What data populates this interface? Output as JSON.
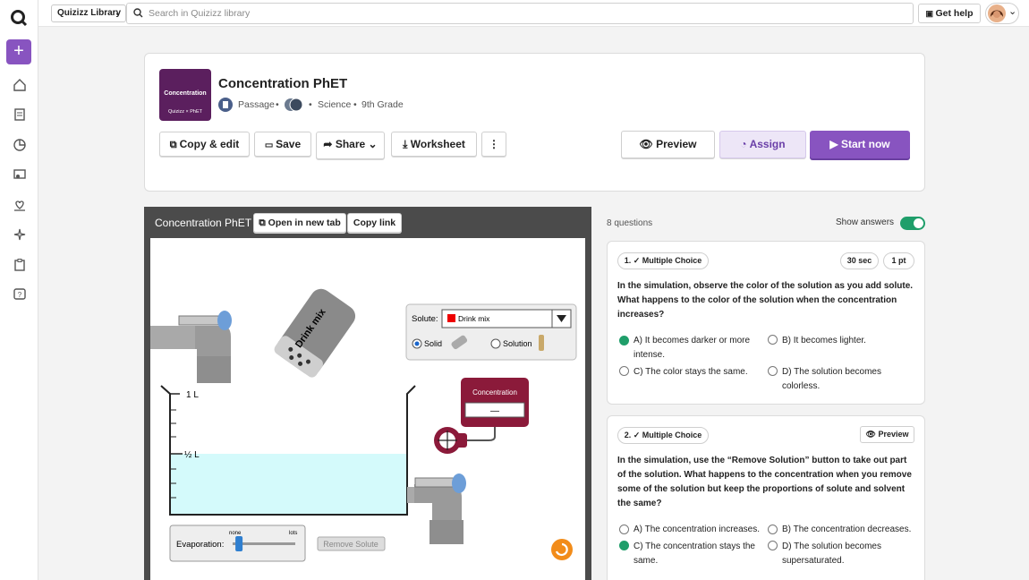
{
  "topbar": {
    "library_select": "Quizizz Library",
    "search_placeholder": "Search in Quizizz library",
    "get_help": "Get help"
  },
  "sidebar": {
    "add_label": "+"
  },
  "quiz": {
    "thumb_title": "Concentration",
    "thumb_brand": "Quizizz × PhET",
    "title": "Concentration PhET",
    "type": "Passage",
    "subject": "Science",
    "grade": "9th Grade"
  },
  "actions": {
    "copy_edit": "Copy & edit",
    "save": "Save",
    "share": "Share",
    "worksheet": "Worksheet",
    "more": "⋮",
    "preview": "Preview",
    "assign": "Assign",
    "start_now": "Start now"
  },
  "sim": {
    "title": "Concentration PhET",
    "open_tab": "Open in new tab",
    "copy_link": "Copy link",
    "shaker_label": "Drink mix",
    "solute_label": "Solute:",
    "solute_value": "Drink mix",
    "solid": "Solid",
    "solution": "Solution",
    "one_l": "1 L",
    "half_l": "½ L",
    "meter_title": "Concentration",
    "meter_value": "—",
    "evap_label": "Evaporation:",
    "evap_none": "none",
    "evap_lots": "lots",
    "remove_solute": "Remove Solute",
    "evaporation_level": 0.05,
    "colors": {
      "solution": "#d4fafb",
      "meter": "#8b1a3a"
    }
  },
  "questions_panel": {
    "count": "8 questions",
    "show_answers": "Show answers",
    "show_answers_on": true
  },
  "questions": [
    {
      "number": "1. ✓ Multiple Choice",
      "time": "30 sec",
      "points": "1 pt",
      "text": "In the simulation, observe the color of the solution as you add solute. What happens to the color of the solution when the concentration increases?",
      "opt_a1": "A) It becomes darker or more",
      "opt_a2": "intense.",
      "opt_b": "B) It becomes lighter.",
      "opt_c": "C) The color stays the same.",
      "opt_d1": "D) The solution becomes",
      "opt_d2": "colorless."
    },
    {
      "number": "2. ✓ Multiple Choice",
      "preview": "Preview",
      "text": "In the simulation, use the “Remove Solution” button to take out part of the solution. What happens to the concentration when you remove some of the solution but keep the proportions of solute and solvent the same?",
      "opt_a": "A) The concentration increases.",
      "opt_b": "B) The concentration decreases.",
      "opt_c1": "C) The concentration stays the",
      "opt_c2": "same.",
      "opt_d1": "D) The solution becomes",
      "opt_d2": "supersaturated."
    }
  ]
}
